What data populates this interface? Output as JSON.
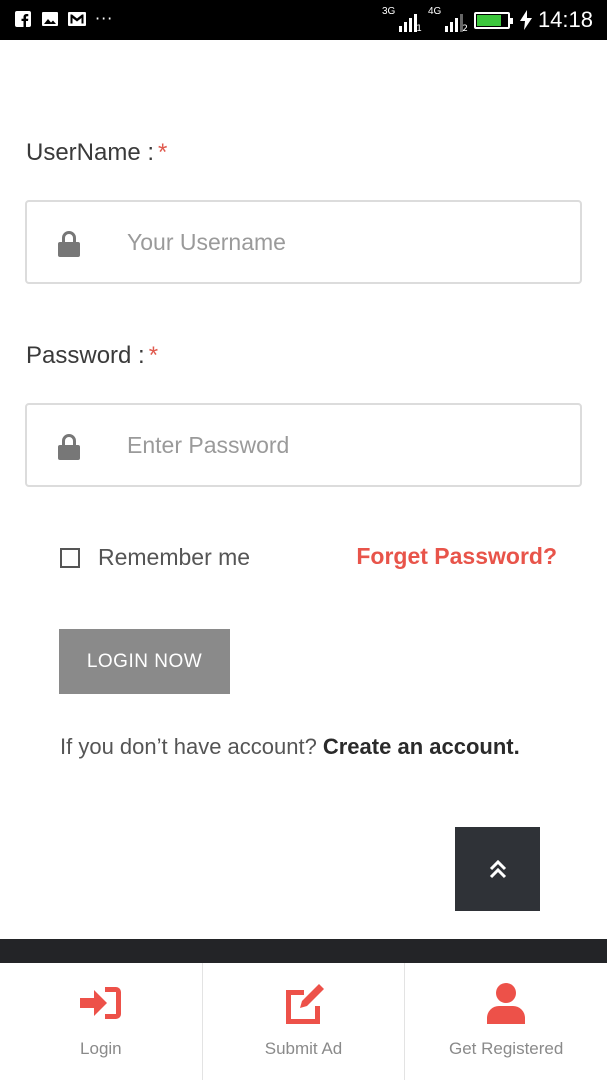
{
  "status_bar": {
    "network_1": "3G",
    "sim_1": "1",
    "network_2": "4G",
    "sim_2": "2",
    "battery_level": 0.8,
    "time": "14:18",
    "notification_icons": [
      "facebook-icon",
      "image-icon",
      "gmail-icon",
      "more-icon"
    ]
  },
  "form": {
    "username": {
      "label": "UserName :",
      "required_mark": "*",
      "placeholder": "Your Username",
      "value": ""
    },
    "password": {
      "label": "Password :",
      "required_mark": "*",
      "placeholder": "Enter Password",
      "value": ""
    },
    "remember_label": "Remember me",
    "remember_checked": false,
    "forget_label": "Forget Password?",
    "login_label": "LOGIN NOW",
    "signup_prompt": "If you don’t have account?",
    "signup_link": "Create an account."
  },
  "bottom_nav": {
    "items": [
      {
        "label": "Login",
        "icon": "sign-in-icon"
      },
      {
        "label": "Submit Ad",
        "icon": "edit-icon"
      },
      {
        "label": "Get Registered",
        "icon": "user-icon"
      }
    ]
  },
  "colors": {
    "accent": "#e8544a",
    "button": "#8a8a8a",
    "scroll_top_bg": "#2f3237"
  }
}
